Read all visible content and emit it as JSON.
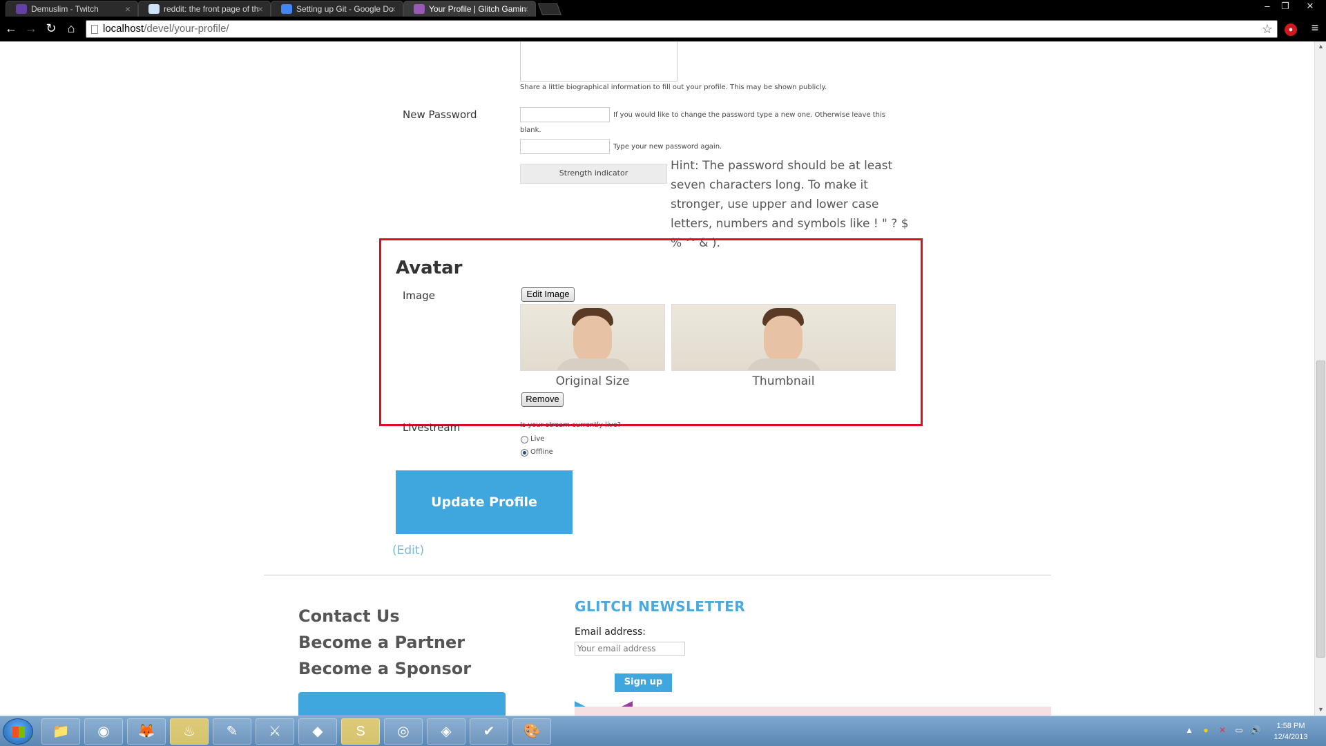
{
  "browser": {
    "tabs": [
      {
        "title": "Demuslim - Twitch",
        "favicon_color": "#6441a5"
      },
      {
        "title": "reddit: the front page of th",
        "favicon_color": "#cee3f8"
      },
      {
        "title": "Setting up Git - Google Do",
        "favicon_color": "#4285f4"
      },
      {
        "title": "Your Profile | Glitch Gamin",
        "favicon_color": "#9b59b6"
      }
    ],
    "tab_close_glyph": "×",
    "window_controls": [
      "–",
      "❐",
      "✕"
    ],
    "nav": {
      "back": "←",
      "forward": "→",
      "reload": "↻",
      "home": "⌂"
    },
    "url_host": "localhost",
    "url_path": "/devel/your-profile/",
    "star_glyph": "☆",
    "menu_glyph": "≡"
  },
  "profile": {
    "bio_help": "Share a little biographical information to fill out your profile. This may be shown publicly.",
    "password": {
      "label": "New Password",
      "help1": "If you would like to change the password type a new one. Otherwise leave this",
      "help1b": "blank.",
      "help2": "Type your new password again.",
      "strength": "Strength indicator",
      "hint": "Hint: The password should be at least seven characters long. To make it stronger, use upper and lower case letters, numbers and symbols like ! \" ? $ % ^ & )."
    },
    "avatar": {
      "heading": "Avatar",
      "image_label": "Image",
      "edit_button": "Edit Image",
      "caption_original": "Original Size",
      "caption_thumbnail": "Thumbnail",
      "remove_button": "Remove",
      "frame_color": "#e00b1f"
    },
    "livestream": {
      "label": "Livestream",
      "question": "Is your stream currently live?",
      "options": [
        {
          "label": "Live",
          "selected": false
        },
        {
          "label": "Offline",
          "selected": true
        }
      ]
    },
    "update_button": "Update Profile",
    "edit_link": "(Edit)"
  },
  "footer": {
    "links": [
      "Contact Us",
      "Become a Partner",
      "Become a Sponsor"
    ],
    "newsletter": {
      "title": "GLITCH NEWSLETTER",
      "email_label": "Email address:",
      "email_placeholder": "Your email address",
      "signup": "Sign up"
    },
    "accent": "#3fa7dd"
  },
  "taskbar": {
    "apps": [
      {
        "name": "explorer-icon",
        "glyph": "📁",
        "active": false
      },
      {
        "name": "chrome-icon",
        "glyph": "◉",
        "active": false
      },
      {
        "name": "firefox-icon",
        "glyph": "🦊",
        "active": false
      },
      {
        "name": "steam-icon",
        "glyph": "♨",
        "active": true
      },
      {
        "name": "editor-icon",
        "glyph": "✎",
        "active": false
      },
      {
        "name": "game-icon",
        "glyph": "⚔",
        "active": false
      },
      {
        "name": "launcher-icon",
        "glyph": "◆",
        "active": false
      },
      {
        "name": "skype-icon",
        "glyph": "S",
        "active": true
      },
      {
        "name": "media-icon",
        "glyph": "◎",
        "active": false
      },
      {
        "name": "git-icon",
        "glyph": "◈",
        "active": false
      },
      {
        "name": "notepad-icon",
        "glyph": "✔",
        "active": false
      },
      {
        "name": "paint-icon",
        "glyph": "🎨",
        "active": false
      }
    ],
    "tray": [
      "▲",
      "●",
      "✕",
      "▭",
      "🔊"
    ],
    "time": "1:58 PM",
    "date": "12/4/2013"
  }
}
